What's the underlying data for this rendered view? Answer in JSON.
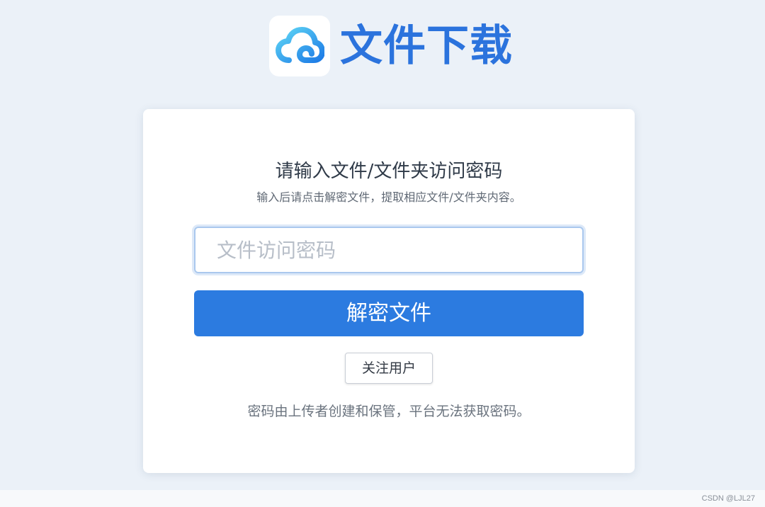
{
  "header": {
    "logo_icon": "cloud-icon",
    "title": "文件下载"
  },
  "card": {
    "title": "请输入文件/文件夹访问密码",
    "subtitle": "输入后请点击解密文件，提取相应文件/文件夹内容。",
    "password_input": {
      "value": "",
      "placeholder": "文件访问密码"
    },
    "decrypt_label": "解密文件",
    "follow_label": "关注用户",
    "footer_note": "密码由上传者创建和保管，平台无法获取密码。"
  },
  "watermark": "CSDN @LJL27",
  "colors": {
    "brand": "#2b73dd",
    "primary_button": "#2c7be0",
    "background": "#ebf1f8",
    "cloud_gradient_start": "#5fd6f5",
    "cloud_gradient_end": "#1d7be6"
  }
}
